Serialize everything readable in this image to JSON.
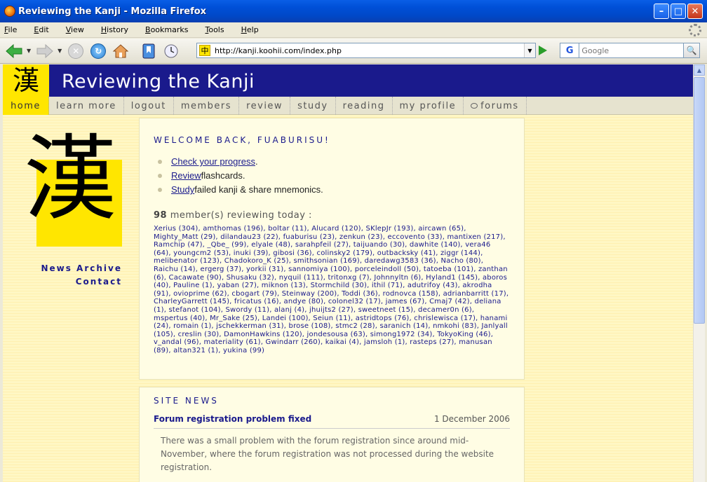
{
  "window": {
    "title": "Reviewing the Kanji - Mozilla Firefox"
  },
  "menu": [
    "File",
    "Edit",
    "View",
    "History",
    "Bookmarks",
    "Tools",
    "Help"
  ],
  "nav": {
    "url": "http://kanji.koohii.com/index.php",
    "search_placeholder": "Google",
    "search_logo": "G"
  },
  "site": {
    "logo_char": "漢",
    "title": "Reviewing the Kanji",
    "nav_items": [
      "home",
      "learn more",
      "logout",
      "members",
      "review",
      "study",
      "reading",
      "my profile",
      "forums"
    ],
    "big_kanji": "漢",
    "side_links": [
      "News Archive",
      "Contact"
    ]
  },
  "welcome": {
    "title": "WELCOME BACK, FUABURISU!",
    "actions": [
      {
        "link": "Check your progress",
        "rest": "."
      },
      {
        "link": "Review",
        "rest": " flashcards."
      },
      {
        "link": "Study",
        "rest": " failed kanji & share mnemonics."
      }
    ],
    "today_count": "98",
    "today_text": "member(s) reviewing today :",
    "members_text": "Xerius (304), amthomas (196), boltar (11), Alucard (120), SKlepJr (193), aircawn (65), Mighty_Matt (29), dilandau23 (22), fuaburisu (23), zenkun (23), eccovento (33), mantixen (217), Ramchip (47), _Qbe_ (99), elyale (48), sarahpfeil (27), taijuando (30), dawhite (140), vera46 (64), youngcm2 (53), inuki (39), gibosi (36), colinsky2 (179), outbacksky (41), ziggr (144), melibenator (123), Chadokoro_K (25), smithsonian (169), daredawg3583 (36), Nacho (80), Raichu (14), ergerg (37), yorkii (31), sannomiya (100), porceleindoll (50), tatoeba (101), zanthan (6), Cacawate (90), Shusaku (32), nyquil (111), tritonxg (7), Johnnyltn (6), Hyland1 (145), aboros (40), Pauline (1), yaban (27), miknon (13), Stormchild (30), ithil (71), adutrifoy (43), akrodha (91), ovioprime (62), cbogart (79), Steinway (200), Toddi (36), rodnovca (158), adrianbarritt (17), CharleyGarrett (145), fricatus (16), andye (80), colonel32 (17), james (67), Cmaj7 (42), deliana (1), stefanot (104), Swordy (11), alanj (4), jhuijts2 (27), sweetneet (15), decamer0n (6), mspertus (40), Mr_Sake (25), Landei (100), Seiun (11), astridtops (76), chrislewisca (17), hanami (24), romain (1), jschekkerman (31), brose (108), stmc2 (28), saranich (14), nmkohi (83), Janlyall (105), creslin (30), DamonHawkins (120), jondesousa (63), simong1972 (34), TokyoKing (46), v_andal (96), materiality (61), Gwindarr (260), kaikai (4), jamsloh (1), rasteps (27), manusan (89), altan321 (1), yukina (99)"
  },
  "news": {
    "title": "SITE NEWS",
    "item_title": "Forum registration problem fixed",
    "item_date": "1 December 2006",
    "item_body": "There was a small problem with the forum registration since around mid-November, where the forum registration was not processed during the website registration."
  }
}
